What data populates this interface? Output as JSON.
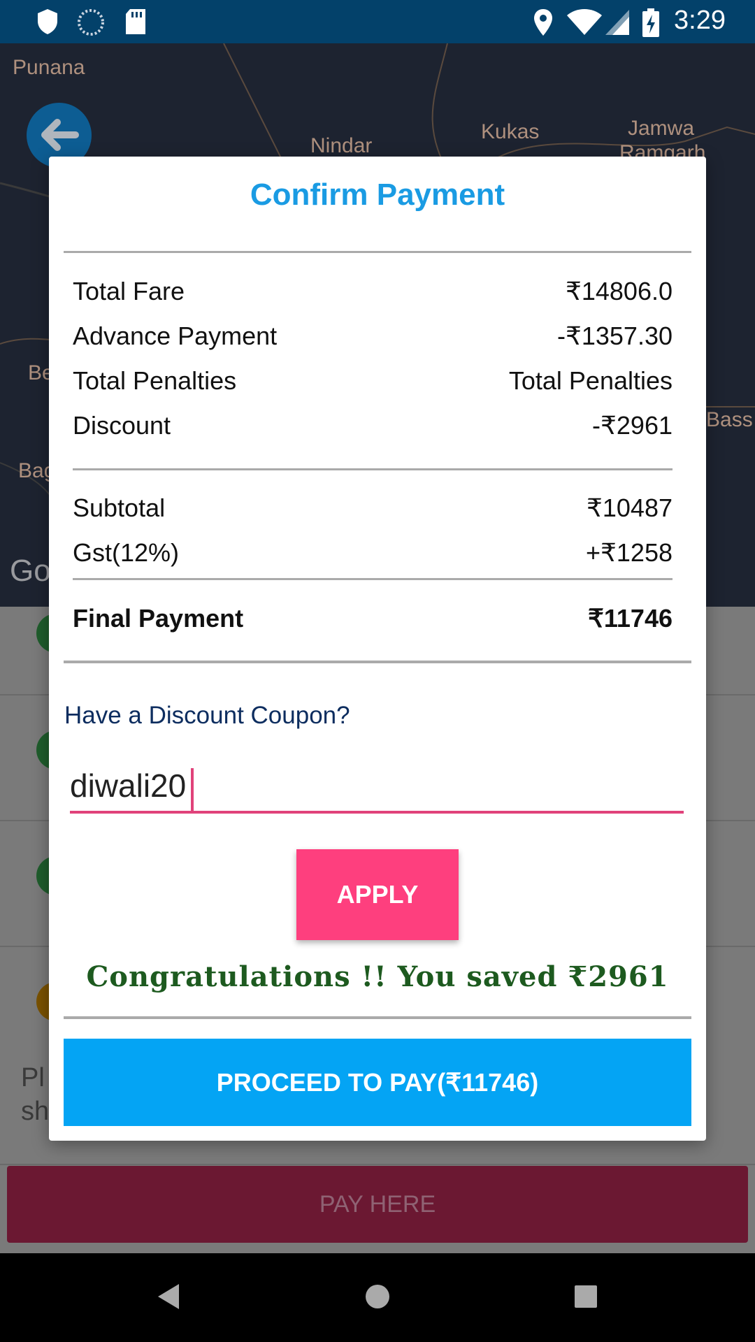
{
  "status_bar": {
    "time": "3:29",
    "icons": [
      "shield-icon",
      "sync-icon",
      "sd-card-icon",
      "location-icon",
      "wifi-icon",
      "signal-icon",
      "battery-charging-icon"
    ]
  },
  "map": {
    "labels": [
      "Punana",
      "Nindar",
      "Kukas",
      "Jamwa",
      "Ramgarh",
      "Be",
      "Bag",
      "Bass"
    ],
    "attribution": "Go"
  },
  "background_list": {
    "note_line1": "Pl",
    "note_line2": "sh",
    "pay_here_label": "PAY HERE"
  },
  "dialog": {
    "title": "Confirm Payment",
    "rows": [
      {
        "label": "Total Fare",
        "value": "₹14806.0"
      },
      {
        "label": "Advance Payment",
        "value": "-₹1357.30"
      },
      {
        "label": "Total Penalties",
        "value": "Total Penalties"
      },
      {
        "label": "Discount",
        "value": "-₹2961"
      }
    ],
    "subtotal": {
      "label": "Subtotal",
      "value": "₹10487"
    },
    "gst": {
      "label": "Gst(12%)",
      "value": "+₹1258"
    },
    "final": {
      "label": "Final Payment",
      "value": "₹11746"
    },
    "coupon_question": "Have a Discount Coupon?",
    "coupon_value": "diwali20",
    "apply_label": "APPLY",
    "congrats_message": "Congratulations !! You saved ₹2961",
    "proceed_label": "PROCEED TO PAY(₹11746)"
  },
  "colors": {
    "accent_blue": "#04a4f4",
    "title_blue": "#1a9be3",
    "apply_pink": "#fe3f7e",
    "congrats_green": "#1d5a1f",
    "status_bar": "#03416a"
  }
}
